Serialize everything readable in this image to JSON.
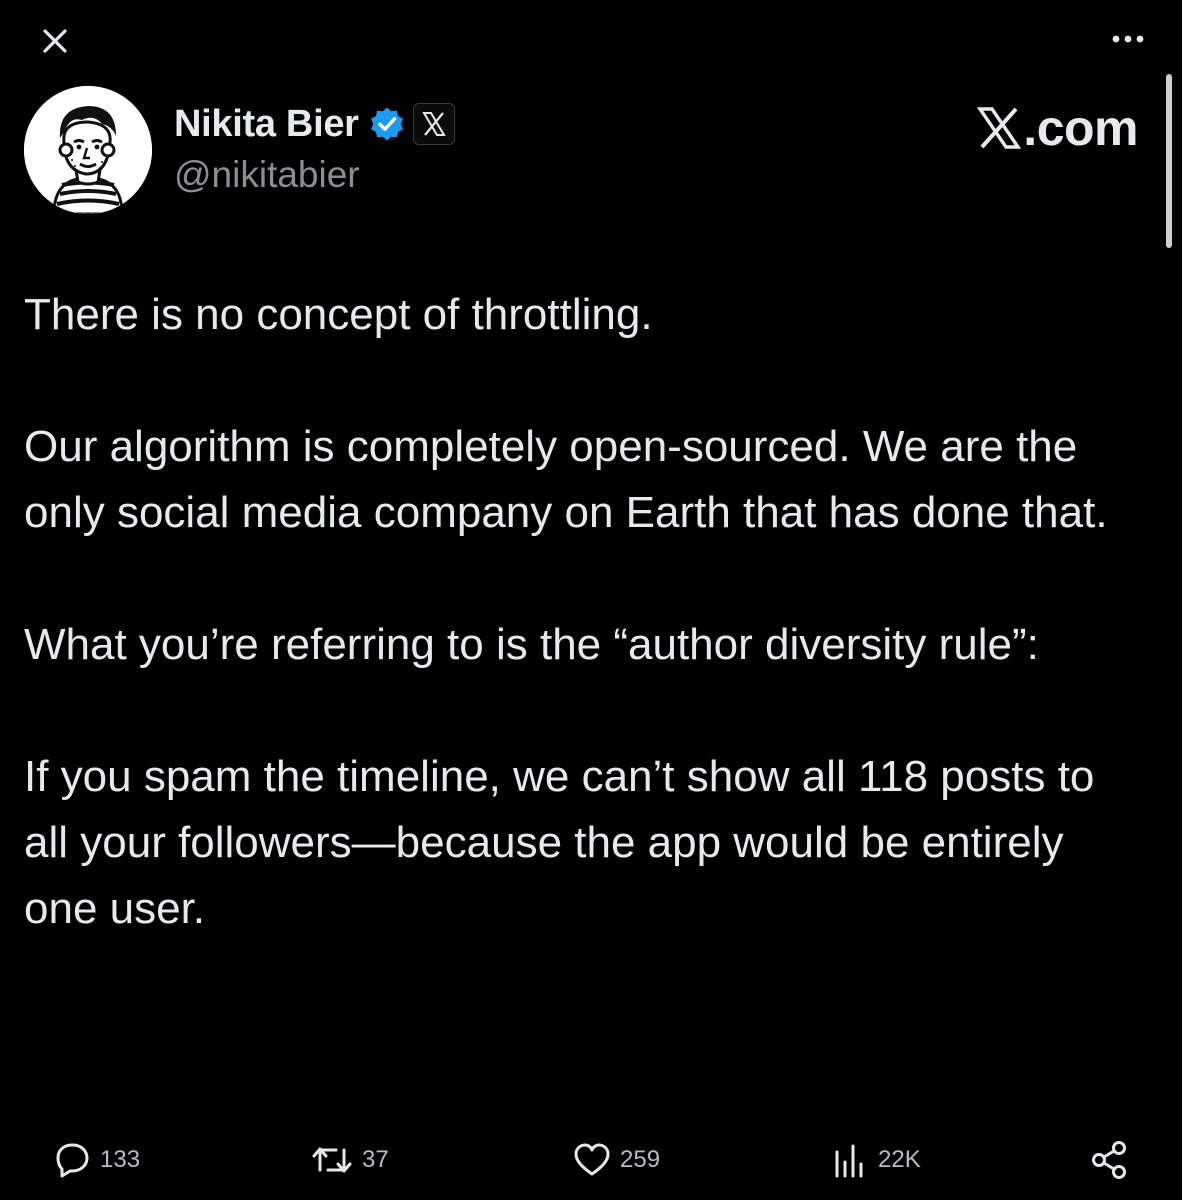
{
  "toolbar": {
    "close_icon": "close-icon",
    "more_icon": "more-horizontal-icon"
  },
  "author": {
    "display_name": "Nikita Bier",
    "handle": "@nikitabier",
    "verified_icon": "verified-badge-icon",
    "verified_color": "#1d9bf0",
    "affiliate_icon": "x-logo-icon"
  },
  "brand": {
    "text": ".com",
    "logo_icon": "x-logo-icon"
  },
  "post": {
    "paragraphs": [
      "There is no concept of throttling.",
      "Our algorithm is completely open-sourced. We are the only social media company on Earth that has done that.",
      "What you’re referring to is the “author diversity rule”:",
      "If you spam the timeline, we can’t show all 118 posts to all your followers—because the app would be entirely one user."
    ]
  },
  "actions": {
    "replies": {
      "icon": "reply-icon",
      "count": "133"
    },
    "reposts": {
      "icon": "repost-icon",
      "count": "37"
    },
    "likes": {
      "icon": "heart-icon",
      "count": "259"
    },
    "views": {
      "icon": "analytics-icon",
      "count": "22K"
    },
    "share": {
      "icon": "share-icon"
    }
  },
  "colors": {
    "background": "#000000",
    "text": "#e7e9ea",
    "secondary_text": "#8b8f94"
  }
}
